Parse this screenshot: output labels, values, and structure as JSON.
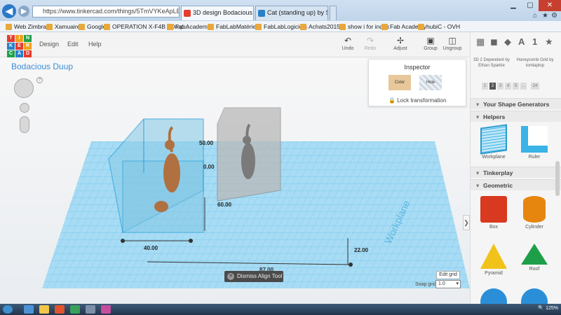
{
  "browser": {
    "url": "https://www.tinkercad.com/things/5TmVYKeApLE-bodacio",
    "tabs": [
      "3D design Bodacious Duup ...",
      "Cat (standing up) by Scintilla ..."
    ]
  },
  "favorites": [
    "Web Zimbra",
    "Xamuaire",
    "Google",
    "OPERATION X-F4B - Drop...",
    "FabAcademy",
    "FabLabMatériel",
    "FabLabLogiciels",
    "Achats2015",
    "show i for index",
    "Fab Academy",
    "hubiC - OVH"
  ],
  "app": {
    "logo_letters": [
      "TIN",
      "KER",
      "CAD"
    ],
    "menu": [
      "Design",
      "Edit",
      "Help"
    ],
    "tools": [
      {
        "label": "Undo",
        "icon": "undo-icon"
      },
      {
        "label": "Redo",
        "icon": "redo-icon"
      },
      {
        "label": "Adjust",
        "icon": "adjust-icon"
      },
      {
        "label": "Group",
        "icon": "group-icon"
      },
      {
        "label": "Ungroup",
        "icon": "ungroup-icon"
      }
    ]
  },
  "canvas": {
    "title": "Bodacious Duup",
    "workplane_text": "Workplane",
    "dimensions": [
      "50.00",
      "0.00",
      "60.00",
      "40.00",
      "22.00",
      "87.00"
    ],
    "dismiss_label": "Dismiss Align Tool",
    "edit_grid_label": "Edit grid",
    "snap_label": "Snap grid",
    "snap_value": "1.0"
  },
  "inspector": {
    "title": "Inspector",
    "color_label": "Color",
    "hole_label": "Hole",
    "lock_label": "Lock transformation"
  },
  "right_panel": {
    "generators": [
      {
        "title": "3D 2 Dependent by Ethan Sparkle"
      },
      {
        "title": "Honeycomb Grid by tomlaptop"
      }
    ],
    "pager": [
      "1",
      "2",
      "3",
      "4",
      "5",
      "...",
      "24"
    ],
    "sections": {
      "your_generators": "Your Shape Generators",
      "helpers": "Helpers",
      "tinkerplay": "Tinkerplay",
      "geometric": "Geometric"
    },
    "helpers": [
      "Workplane",
      "Ruler"
    ],
    "geometric": [
      "Box",
      "Cylinder",
      "Pyramid",
      "Roof"
    ]
  },
  "taskbar": {
    "zoom": "125%"
  },
  "colors": {
    "accent": "#3c8ed6",
    "box": "#d9391f",
    "cylinder": "#e6860e",
    "pyramid": "#f1c21a",
    "roof": "#1f9e4a",
    "workplane": "#3ab3e6"
  }
}
